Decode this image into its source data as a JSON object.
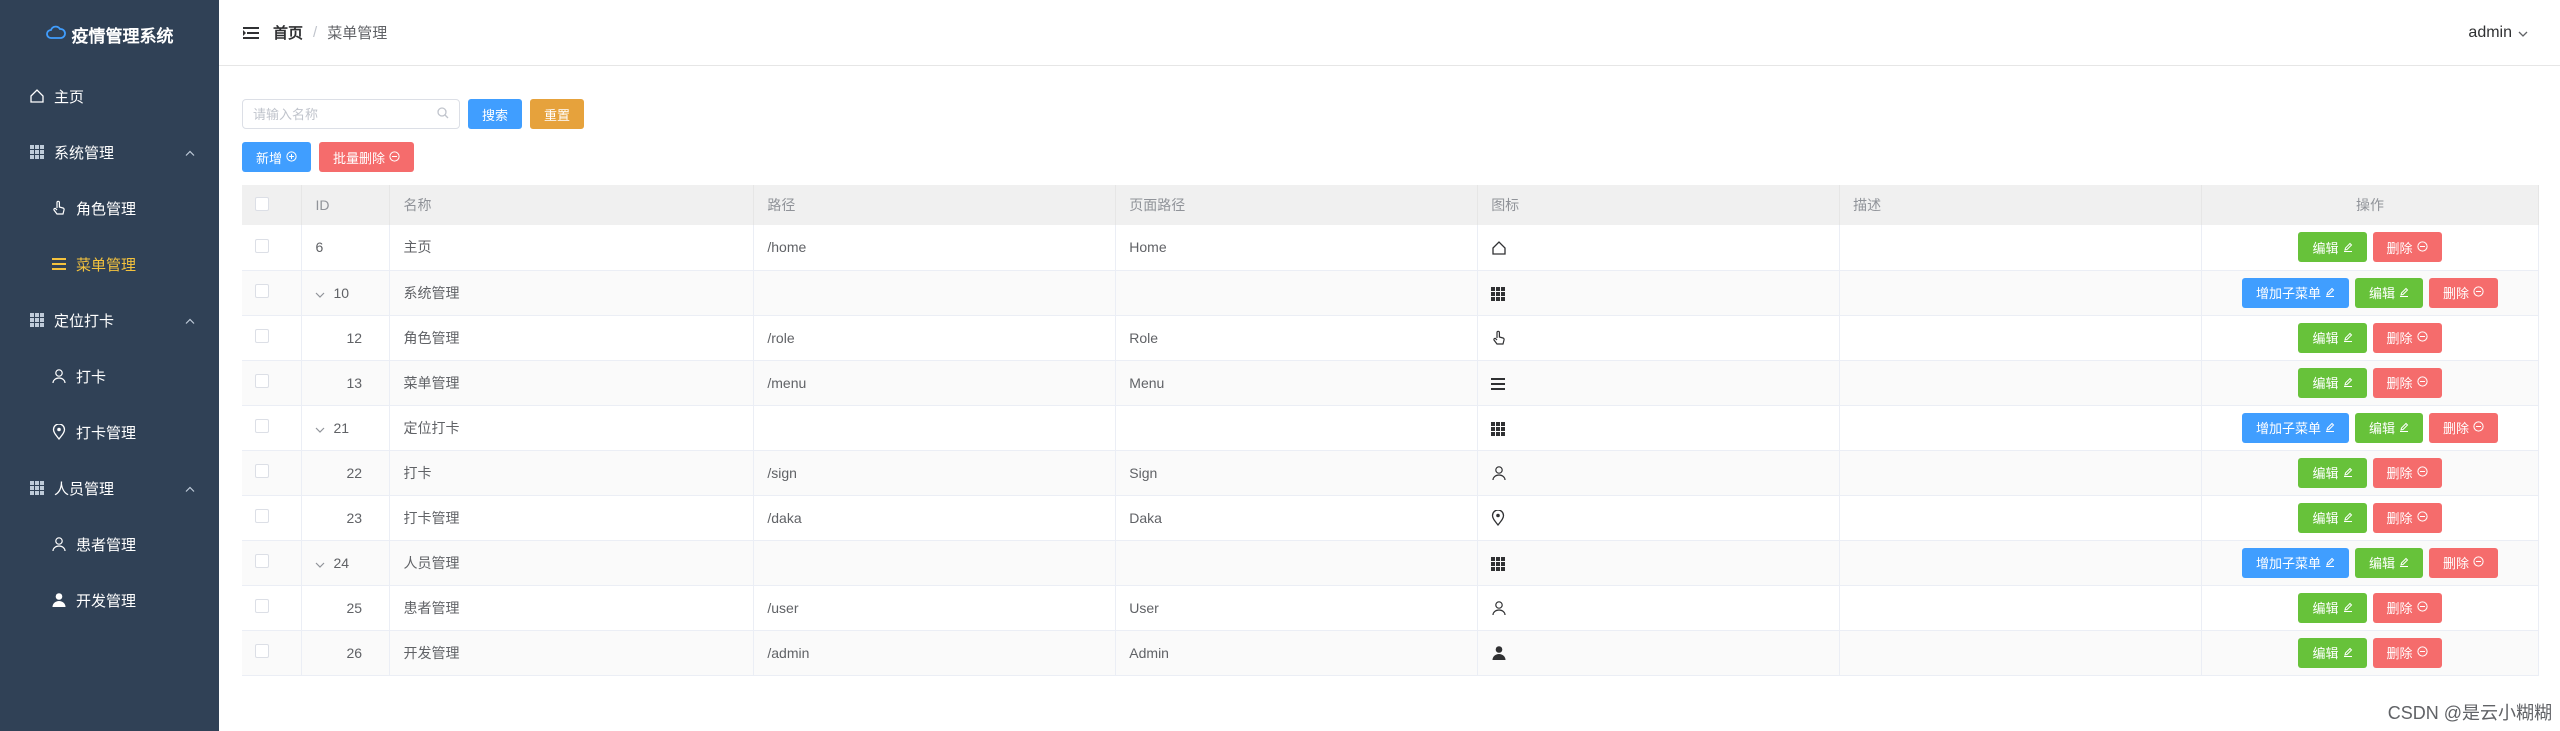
{
  "app_title": "疫情管理系统",
  "sidebar": {
    "items": [
      {
        "label": "主页",
        "icon": "home-icon",
        "level": 0
      },
      {
        "label": "系统管理",
        "icon": "grid-icon",
        "level": 0,
        "arrow": true
      },
      {
        "label": "角色管理",
        "icon": "pointer-icon",
        "level": 1
      },
      {
        "label": "菜单管理",
        "icon": "menu-icon",
        "level": 1,
        "active": true
      },
      {
        "label": "定位打卡",
        "icon": "grid-icon",
        "level": 0,
        "arrow": true
      },
      {
        "label": "打卡",
        "icon": "user-icon",
        "level": 1
      },
      {
        "label": "打卡管理",
        "icon": "location-icon",
        "level": 1
      },
      {
        "label": "人员管理",
        "icon": "grid-icon",
        "level": 0,
        "arrow": true
      },
      {
        "label": "患者管理",
        "icon": "user-icon",
        "level": 1
      },
      {
        "label": "开发管理",
        "icon": "user-solid-icon",
        "level": 1
      }
    ]
  },
  "header": {
    "breadcrumb_home": "首页",
    "breadcrumb_sep": "/",
    "breadcrumb_current": "菜单管理",
    "user": "admin"
  },
  "toolbar": {
    "search_placeholder": "请输入名称",
    "search_label": "搜索",
    "reset_label": "重置",
    "add_label": "新增",
    "batch_delete_label": "批量删除"
  },
  "table": {
    "columns": [
      "ID",
      "名称",
      "路径",
      "页面路径",
      "图标",
      "描述",
      "操作"
    ],
    "add_child_label": "增加子菜单",
    "edit_label": "编辑",
    "delete_label": "删除",
    "rows": [
      {
        "id": "6",
        "name": "主页",
        "path": "/home",
        "page": "Home",
        "icon": "home-icon",
        "desc": "",
        "parent": false,
        "child": false
      },
      {
        "id": "10",
        "name": "系统管理",
        "path": "",
        "page": "",
        "icon": "grid-icon",
        "desc": "",
        "parent": true,
        "child": false
      },
      {
        "id": "12",
        "name": "角色管理",
        "path": "/role",
        "page": "Role",
        "icon": "pointer-icon",
        "desc": "",
        "parent": false,
        "child": true
      },
      {
        "id": "13",
        "name": "菜单管理",
        "path": "/menu",
        "page": "Menu",
        "icon": "menu-icon",
        "desc": "",
        "parent": false,
        "child": true
      },
      {
        "id": "21",
        "name": "定位打卡",
        "path": "",
        "page": "",
        "icon": "grid-icon",
        "desc": "",
        "parent": true,
        "child": false
      },
      {
        "id": "22",
        "name": "打卡",
        "path": "/sign",
        "page": "Sign",
        "icon": "user-icon",
        "desc": "",
        "parent": false,
        "child": true
      },
      {
        "id": "23",
        "name": "打卡管理",
        "path": "/daka",
        "page": "Daka",
        "icon": "location-icon",
        "desc": "",
        "parent": false,
        "child": true
      },
      {
        "id": "24",
        "name": "人员管理",
        "path": "",
        "page": "",
        "icon": "grid-icon",
        "desc": "",
        "parent": true,
        "child": false
      },
      {
        "id": "25",
        "name": "患者管理",
        "path": "/user",
        "page": "User",
        "icon": "user-icon",
        "desc": "",
        "parent": false,
        "child": true
      },
      {
        "id": "26",
        "name": "开发管理",
        "path": "/admin",
        "page": "Admin",
        "icon": "user-solid-icon",
        "desc": "",
        "parent": false,
        "child": true
      }
    ]
  },
  "watermark": "CSDN @是云小糊糊"
}
